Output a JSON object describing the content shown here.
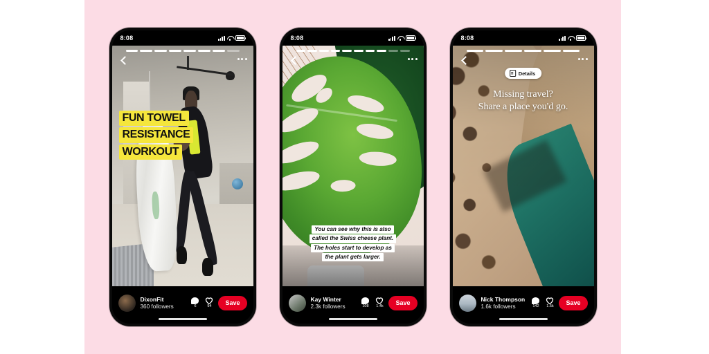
{
  "page": {
    "background_color": "#ffffff",
    "panel_color": "#fcdce5",
    "accent_color": "#e60023"
  },
  "phones": [
    {
      "status": {
        "time": "8:08",
        "signal_icon": "cellular-signal-icon",
        "wifi_icon": "wifi-icon",
        "battery_icon": "battery-icon"
      },
      "story": {
        "segments_total": 8,
        "segments_filled": 7,
        "back_icon": "chevron-left-icon",
        "more_icon": "more-options-icon"
      },
      "overlay": {
        "style": "yellow-highlight",
        "lines": [
          "FUN TOWEL",
          "RESISTANCE",
          "WORKOUT"
        ],
        "highlight_color": "#f5e63c"
      },
      "footer": {
        "avatar": "user-avatar",
        "username": "DixonFit",
        "followers": "360 followers",
        "comment_icon": "comment-icon",
        "comment_count": "6",
        "like_icon": "heart-icon",
        "like_count": "94",
        "save_label": "Save"
      }
    },
    {
      "status": {
        "time": "8:08",
        "signal_icon": "cellular-signal-icon",
        "wifi_icon": "wifi-icon",
        "battery_icon": "battery-icon"
      },
      "story": {
        "segments_total": 10,
        "segments_filled": 8,
        "back_icon": "chevron-left-icon",
        "more_icon": "more-options-icon"
      },
      "overlay": {
        "style": "white-caption",
        "lines": [
          "You can see why this is also",
          "called the Swiss cheese plant.",
          "The holes start to develop as",
          "the plant gets larger."
        ]
      },
      "footer": {
        "avatar": "user-avatar",
        "username": "Kay Winter",
        "followers": "2.3k followers",
        "comment_icon": "comment-icon",
        "comment_count": "108",
        "like_icon": "heart-icon",
        "like_count": "1.4k",
        "save_label": "Save"
      }
    },
    {
      "status": {
        "time": "8:08",
        "signal_icon": "cellular-signal-icon",
        "wifi_icon": "wifi-icon",
        "battery_icon": "battery-icon"
      },
      "story": {
        "segments_total": 6,
        "segments_filled": 6,
        "back_icon": "chevron-left-icon",
        "more_icon": "more-options-icon"
      },
      "details_pill": {
        "label": "Details",
        "icon": "details-card-icon"
      },
      "overlay": {
        "style": "serif-white",
        "line1": "Missing travel?",
        "line2": "Share a place you'd go."
      },
      "footer": {
        "avatar": "user-avatar",
        "username": "Nick Thompson",
        "followers": "1.6k followers",
        "comment_icon": "comment-icon",
        "comment_count": "142",
        "like_icon": "heart-icon",
        "like_count": "1.5k",
        "save_label": "Save"
      }
    }
  ]
}
